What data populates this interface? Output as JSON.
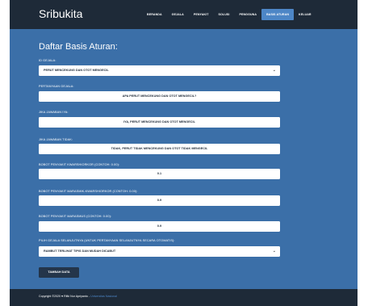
{
  "app": {
    "brand": "Sribukita"
  },
  "nav": {
    "items": [
      "BERANDA",
      "GEJALA",
      "PENYAKIT",
      "SOLUSI",
      "PENGGUNA",
      "BASIS ATURAN",
      "KELUAR"
    ],
    "active": "BASIS ATURAN"
  },
  "page": {
    "title": "Daftar Basis Aturan:"
  },
  "form": {
    "id_gejala": {
      "label": "ID GEJALA:",
      "value": "PERUT MENCEKUNG DAN OTOT MENGECIL"
    },
    "pertanyaan": {
      "label": "PERTANYAAN GEJALA:",
      "value": "APA PERUT MENCEKUNG DAN OTOT MENGECIL?"
    },
    "jawaban_iya": {
      "label": "JIKA JAWABAN IYA:",
      "value": "IYA, PERUT MENCEKUNG DAN OTOT MENGECIL"
    },
    "jawaban_tidak": {
      "label": "JIKA JAWABAN TIDAK:",
      "value": "TIDAK, PERUT TIDAK MENCEKUNG DAN OTOT TIDAK MENGECIL"
    },
    "bobot_kwarshiorkor": {
      "label": "BOBOT PENYAKIT KWARSHIORKOR (CONTOH: 0.00):",
      "value": "0.1"
    },
    "bobot_marasmik": {
      "label": "BOBOT PENYAKIT MARASMIK-KWARSHIORKOR (CONTOH: 0.00):",
      "value": "0.9"
    },
    "bobot_marasmus": {
      "label": "BOBOT PENYAKIT MARASMUS (CONTOH: 0.00):",
      "value": "0.9"
    },
    "gejala_selanjutnya": {
      "label": "PILIH GEJALA SELANJUTNYA (UNTUK PERTANYAAN SELANJUTNYA SECARA OTOMATIS):",
      "value": "RAMBUT TERLIHAT TIPIS DAN MUDAH DICABUT"
    },
    "submit_label": "TAMBAH DATA"
  },
  "footer": {
    "text": "Copyright ©2020 ♥ Rifki Nur Apriyanto - ",
    "link": "Universitas Nasional"
  },
  "colors": {
    "background": "#3b6fa8",
    "navbar": "#1e2a38",
    "accent": "#4d86c6",
    "button": "#24354a"
  },
  "icons": {
    "select_arrow": "chevron-down-icon"
  }
}
